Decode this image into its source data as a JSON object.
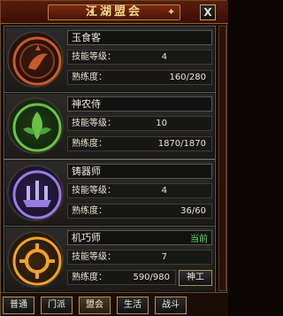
{
  "title": "江湖盟会",
  "titlebar": {
    "help_label": "?",
    "close_label": "X"
  },
  "skills": [
    {
      "name": "玉食客",
      "level_label": "技能等级：",
      "level": "4",
      "proficiency_label": "熟练度：",
      "proficiency": "160/280",
      "emblem": "fish-emblem-icon",
      "color": "#c85a2a"
    },
    {
      "name": "神农侍",
      "level_label": "技能等级：",
      "level": "10",
      "proficiency_label": "熟练度：",
      "proficiency": "1870/1870",
      "emblem": "herb-emblem-icon",
      "color": "#69c244"
    },
    {
      "name": "铸器师",
      "level_label": "技能等级：",
      "level": "4",
      "proficiency_label": "熟练度：",
      "proficiency": "36/60",
      "emblem": "forge-emblem-icon",
      "color": "#9a7be6"
    },
    {
      "name": "机巧师",
      "level_label": "技能等级：",
      "level": "7",
      "proficiency_label": "熟练度：",
      "proficiency": "590/980",
      "emblem": "gear-emblem-icon",
      "color": "#f2a12a",
      "status": "当前",
      "action_label": "神工"
    }
  ],
  "tabs": [
    "普通",
    "门派",
    "盟会",
    "生活",
    "战斗"
  ]
}
